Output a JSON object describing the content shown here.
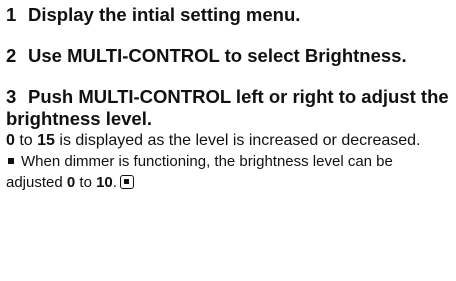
{
  "steps": [
    {
      "number": "1",
      "heading": "Display the intial setting menu."
    },
    {
      "number": "2",
      "heading": "Use MULTI-CONTROL to select Brightness."
    },
    {
      "number": "3",
      "heading": "Push MULTI-CONTROL left or right to adjust the brightness level."
    }
  ],
  "step3_body": {
    "range_start": "0",
    "to_word": "to",
    "range_end": "15",
    "rest": "is displayed as the level is increased or decreased."
  },
  "note": {
    "text": "When dimmer is functioning, the brightness level can be adjusted",
    "range_start": "0",
    "to_word": "to",
    "range_end": "10",
    "period": "."
  },
  "icons": {
    "bullet": "square-bullet-icon",
    "end_mark": "end-of-section-icon"
  }
}
